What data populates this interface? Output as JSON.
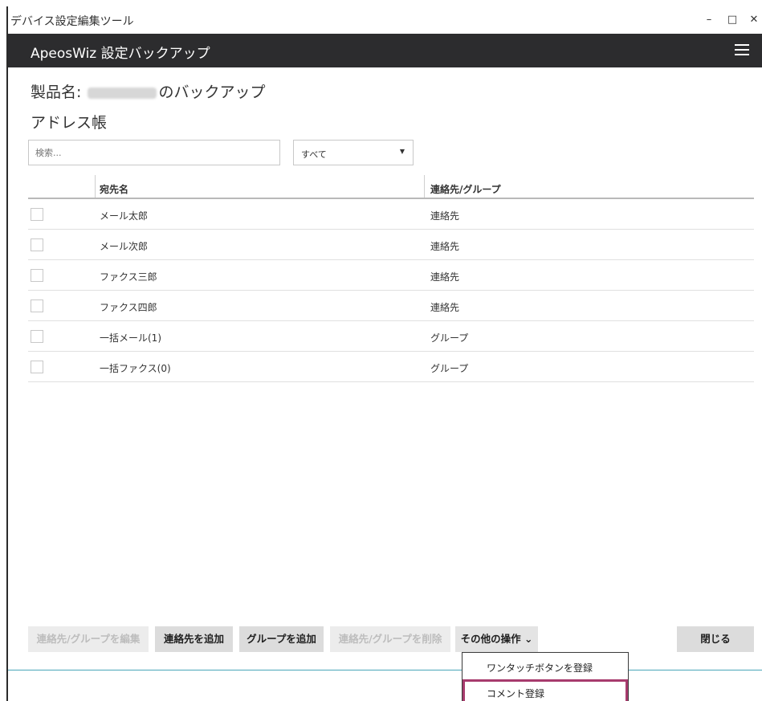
{
  "window": {
    "title": "デバイス設定編集ツール",
    "minimize": "–",
    "maximize": "□",
    "close": "✕"
  },
  "appbar": {
    "title": "ApeosWiz 設定バックアップ"
  },
  "product": {
    "prefix": "製品名: ",
    "suffix": "のバックアップ"
  },
  "section_title": "アドレス帳",
  "search": {
    "placeholder": "検索..."
  },
  "filter": {
    "selected": "すべて"
  },
  "table": {
    "headers": [
      "宛先名",
      "連絡先/グループ"
    ],
    "rows": [
      {
        "name": "メール太郎",
        "type": "連絡先"
      },
      {
        "name": "メール次郎",
        "type": "連絡先"
      },
      {
        "name": "ファクス三郎",
        "type": "連絡先"
      },
      {
        "name": "ファクス四郎",
        "type": "連絡先"
      },
      {
        "name": "一括メール(1)",
        "type": "グループ"
      },
      {
        "name": "一括ファクス(0)",
        "type": "グループ"
      }
    ]
  },
  "buttons": {
    "edit": "連絡先/グループを編集",
    "add_contact": "連絡先を追加",
    "add_group": "グループを追加",
    "delete": "連絡先/グループを削除",
    "more": "その他の操作",
    "close": "閉じる"
  },
  "dropdown": {
    "items": [
      "ワンタッチボタンを登録",
      "コメント登録"
    ]
  },
  "colors": {
    "appbar": "#2c2c2e",
    "highlight": "#a73b6d",
    "divider": "#49a6b8"
  }
}
